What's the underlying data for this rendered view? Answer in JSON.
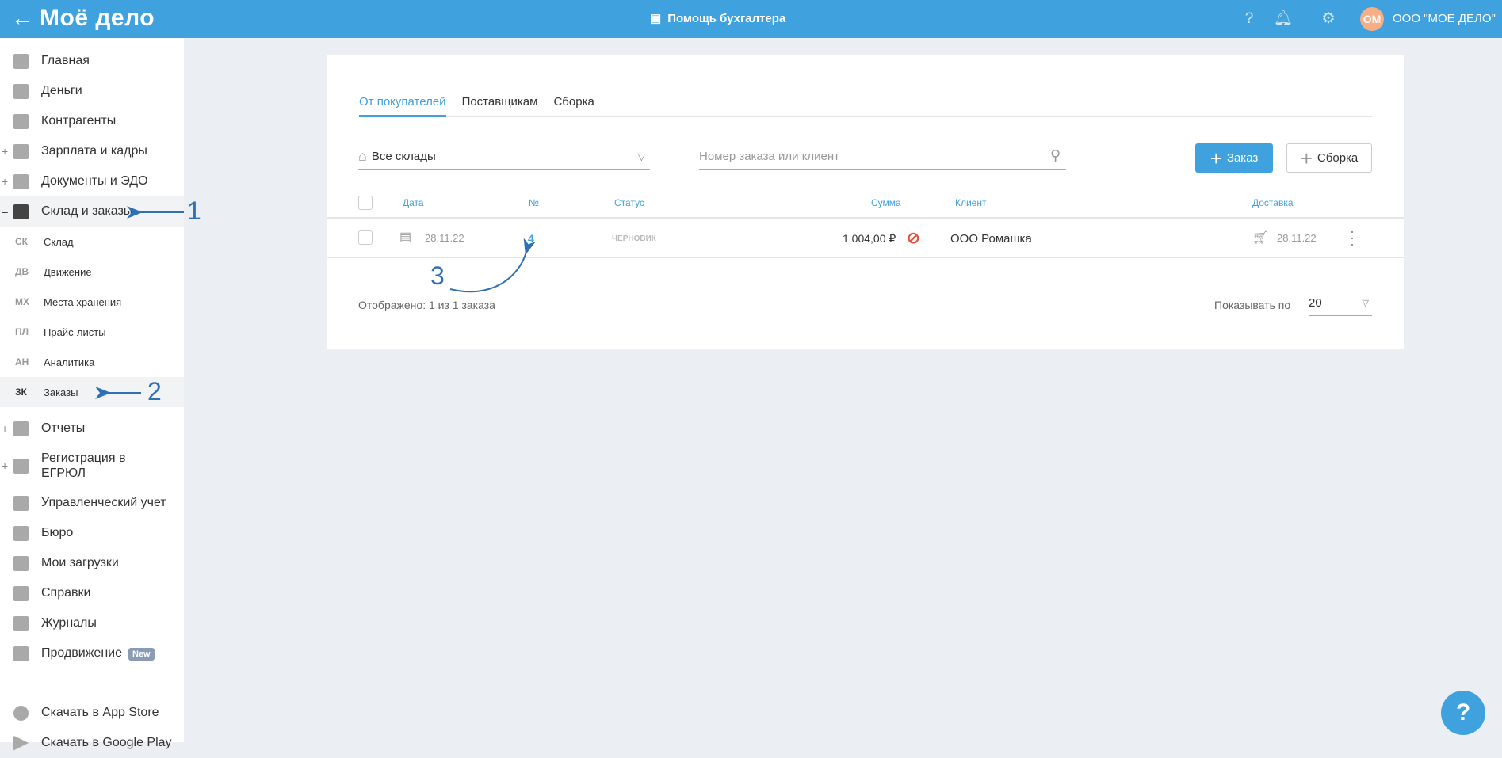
{
  "header": {
    "logo": "Моё дело",
    "help_center": "Помощь бухгалтера",
    "avatar": "ОМ",
    "org": "ООО \"МОЕ ДЕЛО\""
  },
  "sidebar": {
    "items_top": [
      {
        "label": "Главная",
        "icon": "home-icon"
      },
      {
        "label": "Деньги",
        "icon": "money-icon"
      },
      {
        "label": "Контрагенты",
        "icon": "contractor-icon"
      },
      {
        "label": "Зарплата и кадры",
        "icon": "wallet-icon",
        "expand": "+"
      },
      {
        "label": "Документы и ЭДО",
        "icon": "folder-icon",
        "expand": "+"
      },
      {
        "label": "Склад и заказы",
        "icon": "warehouse-icon",
        "expand": "–"
      }
    ],
    "sub": [
      {
        "abbr": "СК",
        "label": "Склад"
      },
      {
        "abbr": "ДВ",
        "label": "Движение"
      },
      {
        "abbr": "МХ",
        "label": "Места хранения"
      },
      {
        "abbr": "ПЛ",
        "label": "Прайс-листы"
      },
      {
        "abbr": "АН",
        "label": "Аналитика"
      },
      {
        "abbr": "ЗК",
        "label": "Заказы"
      }
    ],
    "items_bottom": [
      {
        "label": "Отчеты",
        "expand": "+"
      },
      {
        "label": "Регистрация в ЕГРЮЛ",
        "expand": "+"
      },
      {
        "label": "Управленческий учет"
      },
      {
        "label": "Бюро"
      },
      {
        "label": "Мои загрузки"
      },
      {
        "label": "Справки"
      },
      {
        "label": "Журналы"
      },
      {
        "label": "Продвижение",
        "badge": "New"
      }
    ],
    "apps": [
      {
        "label": "Скачать в App Store"
      },
      {
        "label": "Скачать в Google Play"
      }
    ]
  },
  "tabs": [
    "От покупателей",
    "Поставщикам",
    "Сборка"
  ],
  "filters": {
    "warehouse": "Все склады",
    "search_placeholder": "Номер заказа или клиент",
    "add_order": "Заказ",
    "add_assembly": "Сборка"
  },
  "table": {
    "headers": {
      "date": "Дата",
      "num": "№",
      "status": "Статус",
      "sum": "Сумма",
      "client": "Клиент",
      "delivery": "Доставка"
    },
    "rows": [
      {
        "date": "28.11.22",
        "num": "4",
        "status": "ЧЕРНОВИК",
        "sum": "1 004,00 ₽",
        "client": "ООО Ромашка",
        "delivery": "28.11.22"
      }
    ]
  },
  "footer": {
    "shown": "Отображено: 1 из 1 заказа",
    "per_page_label": "Показывать по",
    "per_page": "20"
  },
  "annotations": [
    "1",
    "2",
    "3"
  ],
  "colors": {
    "accent": "#3fa2de",
    "annotation": "#2f6fb5"
  }
}
